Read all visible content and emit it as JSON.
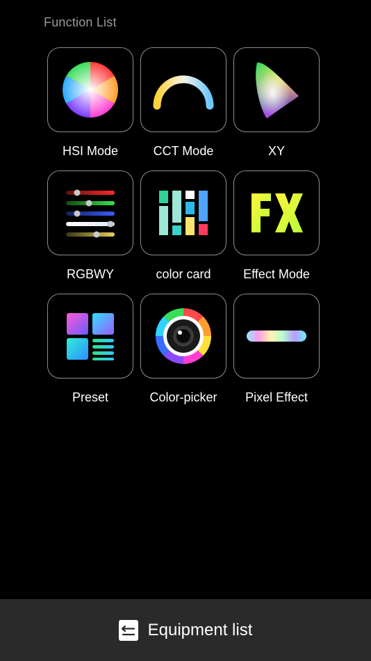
{
  "header": {
    "title": "Function List"
  },
  "functions": [
    {
      "label": "HSI Mode",
      "icon": "color-wheel-icon"
    },
    {
      "label": "CCT Mode",
      "icon": "color-temperature-arc-icon"
    },
    {
      "label": "XY",
      "icon": "cie-gamut-icon"
    },
    {
      "label": "RGBWY",
      "icon": "rgbwy-sliders-icon"
    },
    {
      "label": "color card",
      "icon": "color-card-icon"
    },
    {
      "label": "Effect Mode",
      "icon": "fx-icon"
    },
    {
      "label": "Preset",
      "icon": "preset-grid-icon"
    },
    {
      "label": "Color-picker",
      "icon": "color-picker-camera-icon"
    },
    {
      "label": "Pixel Effect",
      "icon": "pixel-strip-icon"
    }
  ],
  "footer": {
    "label": "Equipment list",
    "icon": "list-return-icon"
  },
  "colors": {
    "background": "#000000",
    "tile_border": "#8e8e8e",
    "footer_background": "#2a2a2a",
    "title_text": "#9a9a9a"
  }
}
